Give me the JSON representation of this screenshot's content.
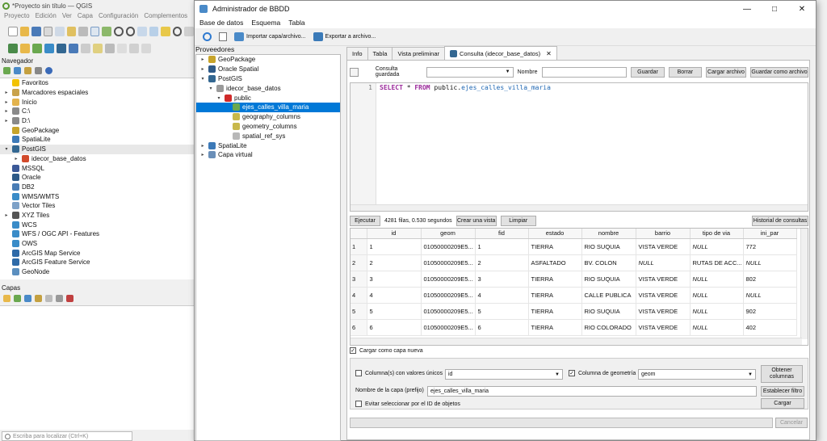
{
  "qgis": {
    "title": "*Proyecto sin título — QGIS",
    "menu": [
      "Proyecto",
      "Edición",
      "Ver",
      "Capa",
      "Configuración",
      "Complementos"
    ],
    "browser_title": "Navegador",
    "browser_items": [
      {
        "label": "Favoritos",
        "expander": "",
        "icon": "star-icon",
        "color": "#f2c200",
        "indent": 0
      },
      {
        "label": "Marcadores espaciales",
        "expander": "▸",
        "icon": "bookmark-icon",
        "color": "#c9a24a",
        "indent": 0
      },
      {
        "label": "Inicio",
        "expander": "▸",
        "icon": "folder-icon",
        "color": "#e3b34d",
        "indent": 0
      },
      {
        "label": "C:\\",
        "expander": "▸",
        "icon": "drive-icon",
        "color": "#8a8a8a",
        "indent": 0
      },
      {
        "label": "D:\\",
        "expander": "▸",
        "icon": "drive-icon",
        "color": "#8a8a8a",
        "indent": 0
      },
      {
        "label": "GeoPackage",
        "expander": "",
        "icon": "geopackage-icon",
        "color": "#c7a42b",
        "indent": 0
      },
      {
        "label": "SpatiaLite",
        "expander": "",
        "icon": "spatialite-icon",
        "color": "#3d7ab8",
        "indent": 0
      },
      {
        "label": "PostGIS",
        "expander": "▾",
        "icon": "postgis-icon",
        "color": "#336791",
        "indent": 0,
        "selected": true
      },
      {
        "label": "idecor_base_datos",
        "expander": "▸",
        "icon": "connection-icon",
        "color": "#d24a2b",
        "indent": 1
      },
      {
        "label": "MSSQL",
        "expander": "",
        "icon": "mssql-icon",
        "color": "#3b5998",
        "indent": 0
      },
      {
        "label": "Oracle",
        "expander": "",
        "icon": "oracle-icon",
        "color": "#2e5a88",
        "indent": 0
      },
      {
        "label": "DB2",
        "expander": "",
        "icon": "db2-icon",
        "color": "#4a7db5",
        "indent": 0
      },
      {
        "label": "WMS/WMTS",
        "expander": "",
        "icon": "globe-icon",
        "color": "#3a8cc8",
        "indent": 0
      },
      {
        "label": "Vector Tiles",
        "expander": "",
        "icon": "vector-tiles-icon",
        "color": "#7da1c7",
        "indent": 0
      },
      {
        "label": "XYZ Tiles",
        "expander": "▸",
        "icon": "xyz-tiles-icon",
        "color": "#555555",
        "indent": 0
      },
      {
        "label": "WCS",
        "expander": "",
        "icon": "globe-icon",
        "color": "#3a8cc8",
        "indent": 0
      },
      {
        "label": "WFS / OGC API - Features",
        "expander": "",
        "icon": "globe-icon",
        "color": "#3a8cc8",
        "indent": 0
      },
      {
        "label": "OWS",
        "expander": "",
        "icon": "globe-icon",
        "color": "#3a8cc8",
        "indent": 0
      },
      {
        "label": "ArcGIS Map Service",
        "expander": "",
        "icon": "arcgis-icon",
        "color": "#2e6aa8",
        "indent": 0
      },
      {
        "label": "ArcGIS Feature Service",
        "expander": "",
        "icon": "arcgis-icon",
        "color": "#2e6aa8",
        "indent": 0
      },
      {
        "label": "GeoNode",
        "expander": "",
        "icon": "geonode-icon",
        "color": "#5b8fbf",
        "indent": 0
      }
    ],
    "layers_title": "Capas",
    "locator_placeholder": "Escriba para localizar (Ctrl+K)"
  },
  "dbm": {
    "title": "Administrador de BBDD",
    "menu": [
      "Base de datos",
      "Esquema",
      "Tabla"
    ],
    "toolbar": {
      "import_label": "Importar capa/archivo...",
      "export_label": "Exportar a archivo..."
    },
    "providers_label": "Proveedores",
    "providers": [
      {
        "label": "GeoPackage",
        "expander": "▸",
        "icon": "geopackage-icon",
        "color": "#c7a42b",
        "indent": 0
      },
      {
        "label": "Oracle Spatial",
        "expander": "▸",
        "icon": "oracle-icon",
        "color": "#2e5a88",
        "indent": 0
      },
      {
        "label": "PostGIS",
        "expander": "▾",
        "icon": "postgis-icon",
        "color": "#336791",
        "indent": 0
      },
      {
        "label": "idecor_base_datos",
        "expander": "▾",
        "icon": "database-icon",
        "color": "#9a9a9a",
        "indent": 1
      },
      {
        "label": "public",
        "expander": "▾",
        "icon": "schema-icon",
        "color": "#d02a2a",
        "indent": 2
      },
      {
        "label": "ejes_calles_villa_maria",
        "expander": "",
        "icon": "line-layer-icon",
        "color": "#6aa84f",
        "indent": 3,
        "selected": true
      },
      {
        "label": "geography_columns",
        "expander": "",
        "icon": "table-icon",
        "color": "#c8b84a",
        "indent": 3
      },
      {
        "label": "geometry_columns",
        "expander": "",
        "icon": "table-icon",
        "color": "#c8b84a",
        "indent": 3
      },
      {
        "label": "spatial_ref_sys",
        "expander": "",
        "icon": "table-icon",
        "color": "#b8b8b8",
        "indent": 3
      },
      {
        "label": "SpatiaLite",
        "expander": "▸",
        "icon": "spatialite-icon",
        "color": "#3d7ab8",
        "indent": 0
      },
      {
        "label": "Capa virtual",
        "expander": "▸",
        "icon": "virtual-layer-icon",
        "color": "#6a8fb8",
        "indent": 0
      }
    ],
    "tabs": [
      "Info",
      "Tabla",
      "Vista preliminar",
      "Consulta (idecor_base_datos)"
    ],
    "query": {
      "saved_label": "Consulta guardada",
      "saved_value": "",
      "name_label": "Nombre",
      "name_value": "",
      "save_button": "Guardar",
      "delete_button": "Borrar",
      "load_file_button": "Cargar archivo",
      "save_as_file_button": "Guardar como archivo",
      "line_number": "1",
      "sql_keyword_1": "SELECT",
      "sql_star": " * ",
      "sql_keyword_2": "FROM",
      "sql_schema": " public.",
      "sql_table": "ejes_calles_villa_maria"
    },
    "exec": {
      "execute_button": "Ejecutar",
      "status": "4281 filas, 0.530 segundos",
      "create_view_button": "Crear una vista",
      "clear_button": "Limpiar",
      "history_button": "Historial de consultas"
    },
    "result": {
      "columns": [
        "id",
        "geom",
        "fid",
        "estado",
        "nombre",
        "barrio",
        "tipo de via",
        "ini_par"
      ],
      "rows": [
        [
          "1",
          "1",
          "01050000209E5...",
          "1",
          "TIERRA",
          "RIO SUQUIA",
          "VISTA VERDE",
          "NULL",
          "772"
        ],
        [
          "2",
          "2",
          "01050000209E5...",
          "2",
          "ASFALTADO",
          "BV. COLON",
          "NULL",
          "RUTAS DE ACC...",
          "NULL"
        ],
        [
          "3",
          "3",
          "01050000209E5...",
          "3",
          "TIERRA",
          "RIO SUQUIA",
          "VISTA VERDE",
          "NULL",
          "802"
        ],
        [
          "4",
          "4",
          "01050000209E5...",
          "4",
          "TIERRA",
          "CALLE PUBLICA",
          "VISTA VERDE",
          "NULL",
          "NULL"
        ],
        [
          "5",
          "5",
          "01050000209E5...",
          "5",
          "TIERRA",
          "RIO SUQUIA",
          "VISTA VERDE",
          "NULL",
          "902"
        ],
        [
          "6",
          "6",
          "01050000209E5...",
          "6",
          "TIERRA",
          "RIO COLORADO",
          "VISTA VERDE",
          "NULL",
          "402"
        ]
      ]
    },
    "load": {
      "load_as_new_layer": "Cargar como capa nueva",
      "unique_values_label": "Columna(s) con valores únicos",
      "unique_values_value": "id",
      "geometry_column_label": "Columna de geometría",
      "geometry_column_value": "geom",
      "get_columns_button": "Obtener columnas",
      "layer_name_label": "Nombre de la capa (prefijo)",
      "layer_name_value": "ejes_calles_villa_maria",
      "set_filter_button": "Establecer filtro",
      "avoid_select_label": "Evitar seleccionar por el ID de objetos",
      "load_button": "Cargar",
      "cancel_button": "Cancelar"
    }
  }
}
